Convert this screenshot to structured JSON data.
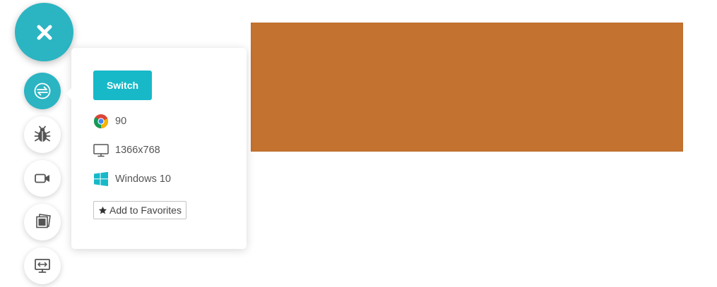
{
  "colors": {
    "accent": "#2bb4c2",
    "switch_button": "#17b9c8",
    "content_block": "#c4722f"
  },
  "fab": {
    "icon": "close-icon"
  },
  "side_buttons": [
    {
      "name": "switch-session",
      "icon": "switch-arrows-icon",
      "active": true
    },
    {
      "name": "bug-report",
      "icon": "bug-icon",
      "active": false
    },
    {
      "name": "record-video",
      "icon": "video-camera-icon",
      "active": false
    },
    {
      "name": "screenshots",
      "icon": "gallery-icon",
      "active": false
    },
    {
      "name": "resolution",
      "icon": "monitor-resize-icon",
      "active": false
    }
  ],
  "popover": {
    "switch_label": "Switch",
    "browser_version": "90",
    "browser_icon": "chrome-icon",
    "resolution": "1366x768",
    "resolution_icon": "monitor-icon",
    "os": "Windows 10",
    "os_icon": "windows-icon",
    "favorites_label": "Add to Favorites",
    "favorites_icon": "star-icon"
  }
}
